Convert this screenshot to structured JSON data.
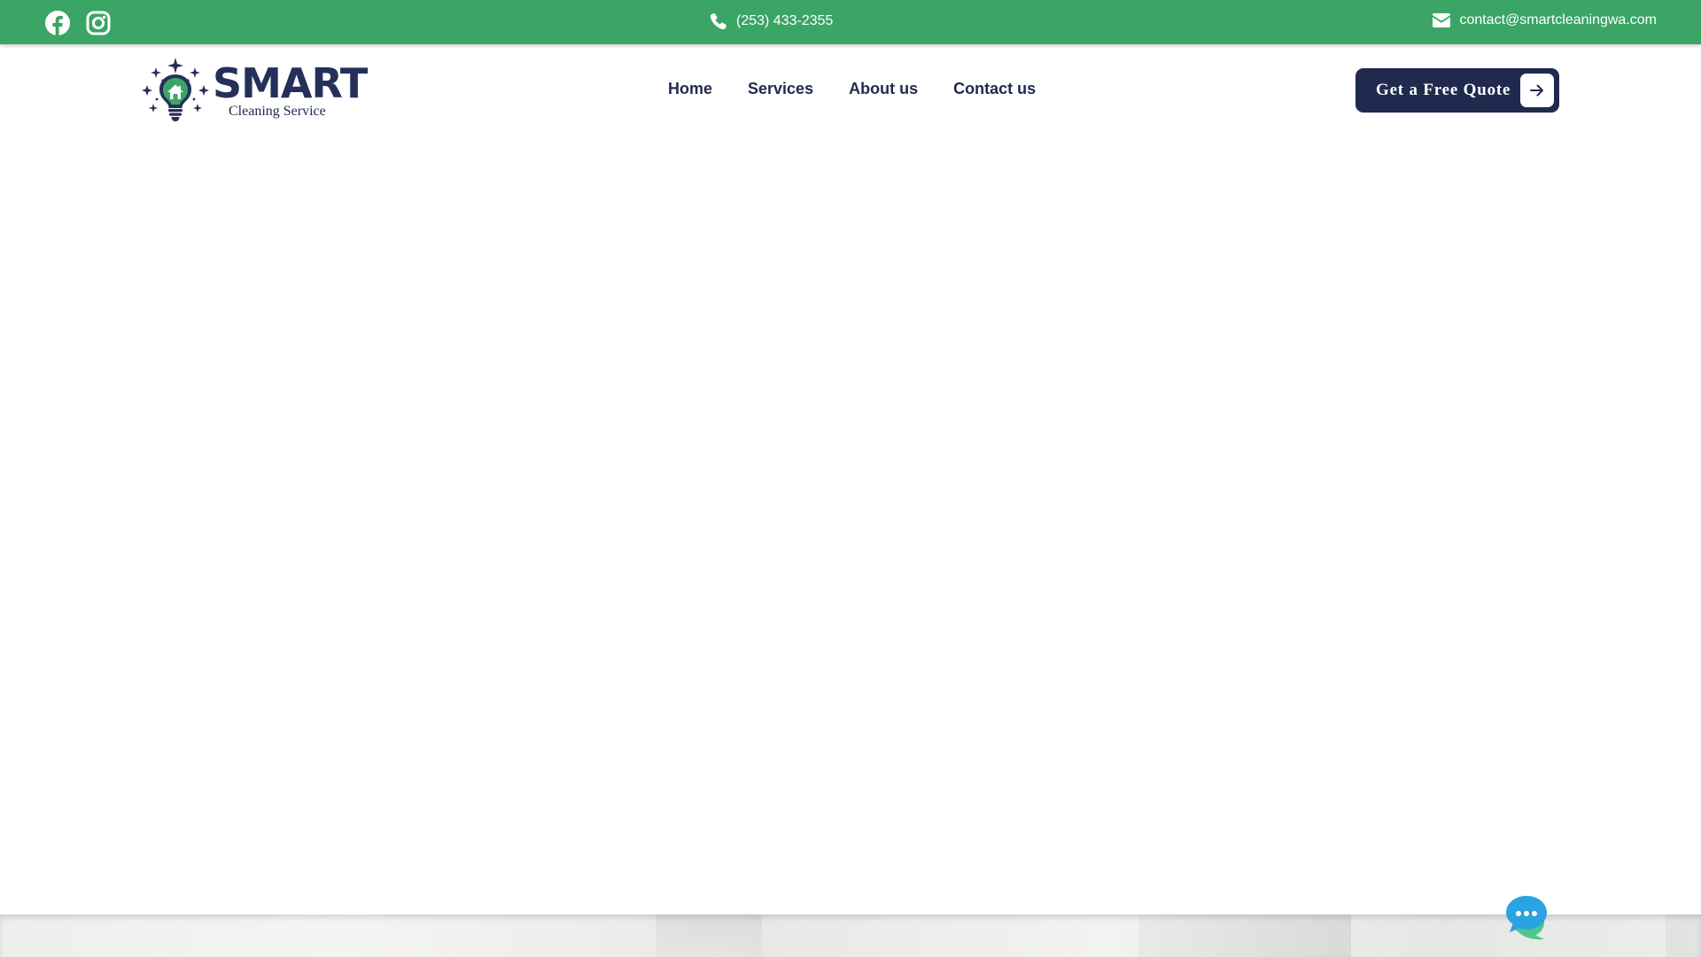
{
  "topbar": {
    "background": "#3ba566",
    "social": [
      {
        "icon": "facebook-icon"
      },
      {
        "icon": "instagram-icon"
      }
    ],
    "phone": {
      "icon": "phone-icon",
      "text": "(253) 433-2355"
    },
    "email": {
      "icon": "envelope-icon",
      "text": "contact@smartcleaningwa.com"
    }
  },
  "header": {
    "logo": {
      "title": "SMART",
      "subtitle": "Cleaning Service",
      "icon": "lightbulb-house-logo"
    },
    "nav": [
      {
        "label": "Home"
      },
      {
        "label": "Services"
      },
      {
        "label": "About us"
      },
      {
        "label": "Contact us"
      }
    ],
    "cta": {
      "label": "Get a Free Quote",
      "icon": "arrow-right-icon",
      "color": "#1f2a4e"
    }
  },
  "chat_widget": {
    "icon": "chat-bubbles-icon"
  },
  "colors": {
    "accent": "#3ba566",
    "navy": "#1f2a4e",
    "chat_blue": "#2ba3e0",
    "chat_green": "#4cc98a"
  }
}
